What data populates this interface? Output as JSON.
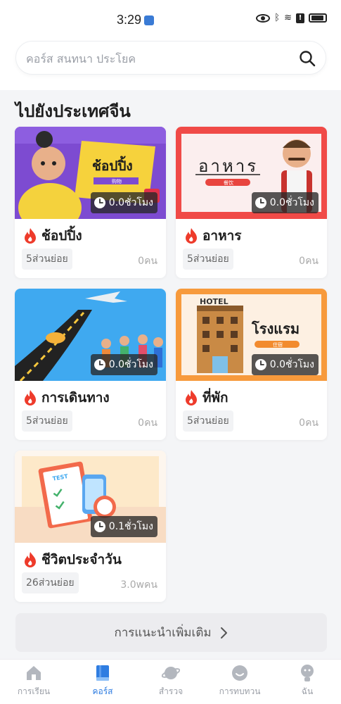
{
  "status_bar": {
    "time": "3:29"
  },
  "search": {
    "placeholder": "คอร์ส สนทนา ประโยค"
  },
  "section": {
    "title": "ไปยังประเทศจีน"
  },
  "cards": [
    {
      "banner_text": "ช้อปปิ้ง",
      "banner_sub": "购物",
      "duration": "0.0ชั่วโมง",
      "title": "ช้อปปิ้ง",
      "subunits": "5ส่วนย่อย",
      "learners": "0คน"
    },
    {
      "banner_text": "อาหาร",
      "banner_sub": "餐饮",
      "duration": "0.0ชั่วโมง",
      "title": "อาหาร",
      "subunits": "5ส่วนย่อย",
      "learners": "0คน"
    },
    {
      "banner_text": "",
      "banner_sub": "",
      "duration": "0.0ชั่วโมง",
      "title": "การเดินทาง",
      "subunits": "5ส่วนย่อย",
      "learners": "0คน"
    },
    {
      "banner_text": "โรงแรม",
      "banner_sub": "住宿",
      "banner_sign": "HOTEL",
      "duration": "0.0ชั่วโมง",
      "title": "ที่พัก",
      "subunits": "5ส่วนย่อย",
      "learners": "0คน"
    },
    {
      "banner_text": "",
      "banner_sub": "",
      "banner_sign": "TEST",
      "duration": "0.1ชั่วโมง",
      "title": "ชีวิตประจำวัน",
      "subunits": "26ส่วนย่อย",
      "learners": "3.0wคน"
    }
  ],
  "more": {
    "label": "การแนะนำเพิ่มเติม"
  },
  "bottom_nav": [
    {
      "label": "การเรียน",
      "icon": "home-icon",
      "active": false
    },
    {
      "label": "คอร์ส",
      "icon": "book-icon",
      "active": true
    },
    {
      "label": "สำรวจ",
      "icon": "planet-icon",
      "active": false
    },
    {
      "label": "การทบทวน",
      "icon": "review-icon",
      "active": false
    },
    {
      "label": "ฉัน",
      "icon": "profile-icon",
      "active": false
    }
  ],
  "colors": {
    "accent": "#2f7de1",
    "fire": "#ee3b2b",
    "shopping_banner": "#7d4bd1",
    "food_banner": "#f04a47",
    "travel_banner": "#3fa9f0",
    "hotel_banner": "#f79a3c",
    "daily_banner": "#fde9c9"
  }
}
